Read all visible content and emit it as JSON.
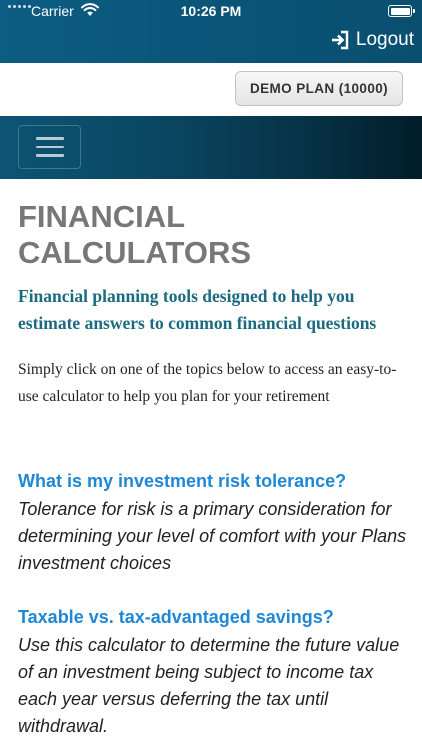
{
  "status_bar": {
    "carrier": "Carrier",
    "time": "10:26 PM"
  },
  "header": {
    "logout_label": "Logout",
    "logout_icon": "logout-icon"
  },
  "plan": {
    "label": "DEMO PLAN (10000)"
  },
  "nav": {
    "menu_icon": "hamburger-menu-icon"
  },
  "main": {
    "title": "FINANCIAL CALCULATORS",
    "subtitle": "Financial planning tools designed to help you estimate answers to common financial questions",
    "intro": "Simply click on one of the topics below to access an easy-to-use calculator to help you plan for your retirement",
    "topics": [
      {
        "title": "What is my investment risk tolerance?",
        "description": "Tolerance for risk is a primary consideration for determining your level of comfort with your Plans investment choices"
      },
      {
        "title": "Taxable vs. tax-advantaged savings?",
        "description": "Use this calculator to determine the future value of an investment being subject to income tax each year versus deferring the tax until withdrawal."
      }
    ]
  },
  "colors": {
    "header_bg": "#0a5478",
    "link": "#1e88d6",
    "subtitle": "#1b6a80",
    "title": "#777777"
  }
}
